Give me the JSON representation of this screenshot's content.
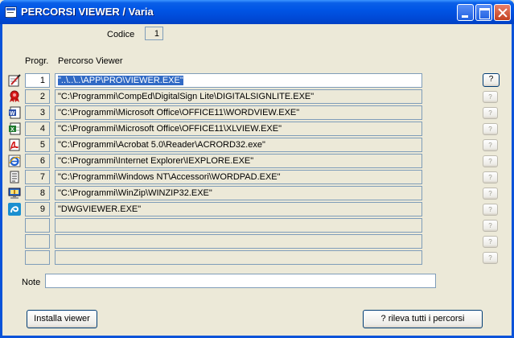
{
  "window": {
    "title": "PERCORSI VIEWER / Varia"
  },
  "codice": {
    "label": "Codice",
    "value": "1"
  },
  "headers": {
    "progr": "Progr.",
    "percorso": "Percorso Viewer"
  },
  "rows": [
    {
      "num": "1",
      "path": "\"..\\..\\..\\APP\\PRO\\VIEWER.EXE\"",
      "icon": "pen-document-icon",
      "button": "?",
      "active": true
    },
    {
      "num": "2",
      "path": "\"C:\\Programmi\\CompEd\\DigitalSign Lite\\DIGITALSIGNLITE.EXE\"",
      "icon": "digital-sign-ribbon-icon",
      "button": "?"
    },
    {
      "num": "3",
      "path": "\"C:\\Programmi\\Microsoft Office\\OFFICE11\\WORDVIEW.EXE\"",
      "icon": "word-viewer-icon",
      "button": "?"
    },
    {
      "num": "4",
      "path": "\"C:\\Programmi\\Microsoft Office\\OFFICE11\\XLVIEW.EXE\"",
      "icon": "excel-viewer-icon",
      "button": "?"
    },
    {
      "num": "5",
      "path": "\"C:\\Programmi\\Acrobat 5.0\\Reader\\ACRORD32.exe\"",
      "icon": "acrobat-reader-icon",
      "button": "?"
    },
    {
      "num": "6",
      "path": "\"C:\\Programmi\\Internet Explorer\\IEXPLORE.EXE\"",
      "icon": "internet-explorer-icon",
      "button": "?"
    },
    {
      "num": "7",
      "path": "\"C:\\Programmi\\Windows NT\\Accessori\\WORDPAD.EXE\"",
      "icon": "wordpad-icon",
      "button": "?"
    },
    {
      "num": "8",
      "path": "\"C:\\Programmi\\WinZip\\WINZIP32.EXE\"",
      "icon": "winzip-icon",
      "button": "?"
    },
    {
      "num": "9",
      "path": "\"DWGVIEWER.EXE\"",
      "icon": "dwg-viewer-icon",
      "button": "?"
    },
    {
      "num": "",
      "path": "",
      "icon": "",
      "button": "?"
    },
    {
      "num": "",
      "path": "",
      "icon": "",
      "button": "?"
    },
    {
      "num": "",
      "path": "",
      "icon": "",
      "button": "?"
    }
  ],
  "note": {
    "label": "Note",
    "value": ""
  },
  "buttons": {
    "installa": "Installa viewer",
    "rileva": "? rileva tutti i percorsi"
  },
  "colors": {
    "titlebar": "#0055E5",
    "selection": "#316AC5",
    "face": "#ECE9D8",
    "border": "#7F9DB9"
  }
}
